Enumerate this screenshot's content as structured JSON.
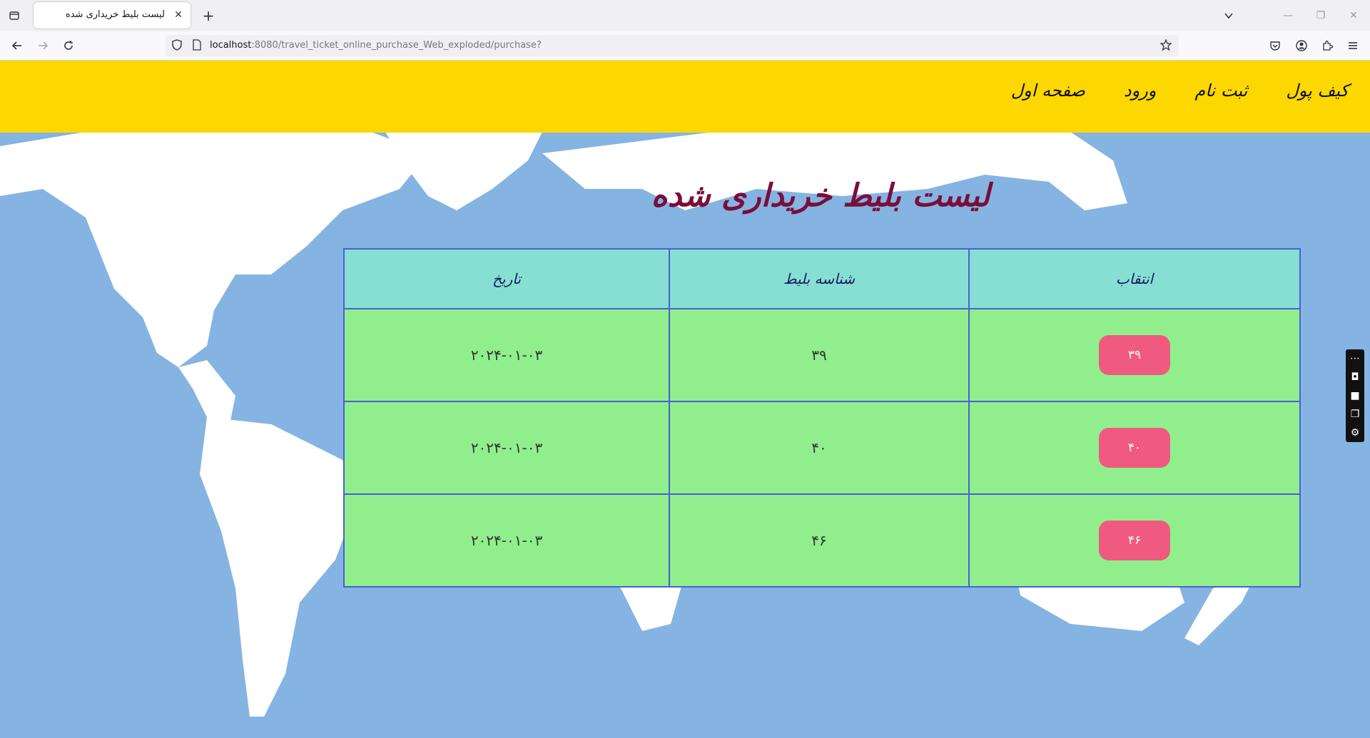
{
  "browser": {
    "tab_title": "لیست بلیط خریداری شده",
    "url_host": "localhost",
    "url_path": ":8080/travel_ticket_online_purchase_Web_exploded/purchase?"
  },
  "header": {
    "menu": [
      {
        "label": "صفحه اول"
      },
      {
        "label": "ورود"
      },
      {
        "label": "ثبت نام"
      },
      {
        "label": "کیف پول"
      }
    ]
  },
  "main": {
    "title": "لیست بلیط خریداری شده",
    "table": {
      "columns": [
        "انتقاب",
        "شناسه بلیط",
        "تاریخ"
      ],
      "rows": [
        {
          "select": "۳۹",
          "ticket_id": "۳۹",
          "date": "۲۰۲۴-۰۱-۰۳"
        },
        {
          "select": "۴۰",
          "ticket_id": "۴۰",
          "date": "۲۰۲۴-۰۱-۰۳"
        },
        {
          "select": "۴۶",
          "ticket_id": "۴۶",
          "date": "۲۰۲۴-۰۱-۰۳"
        }
      ]
    }
  },
  "colors": {
    "header_bg": "#fdd700",
    "ocean": "#85b4e2",
    "table_head": "#86dfd2",
    "table_body": "#90ef8c",
    "button": "#f05a80",
    "title": "#7a0e3a"
  }
}
